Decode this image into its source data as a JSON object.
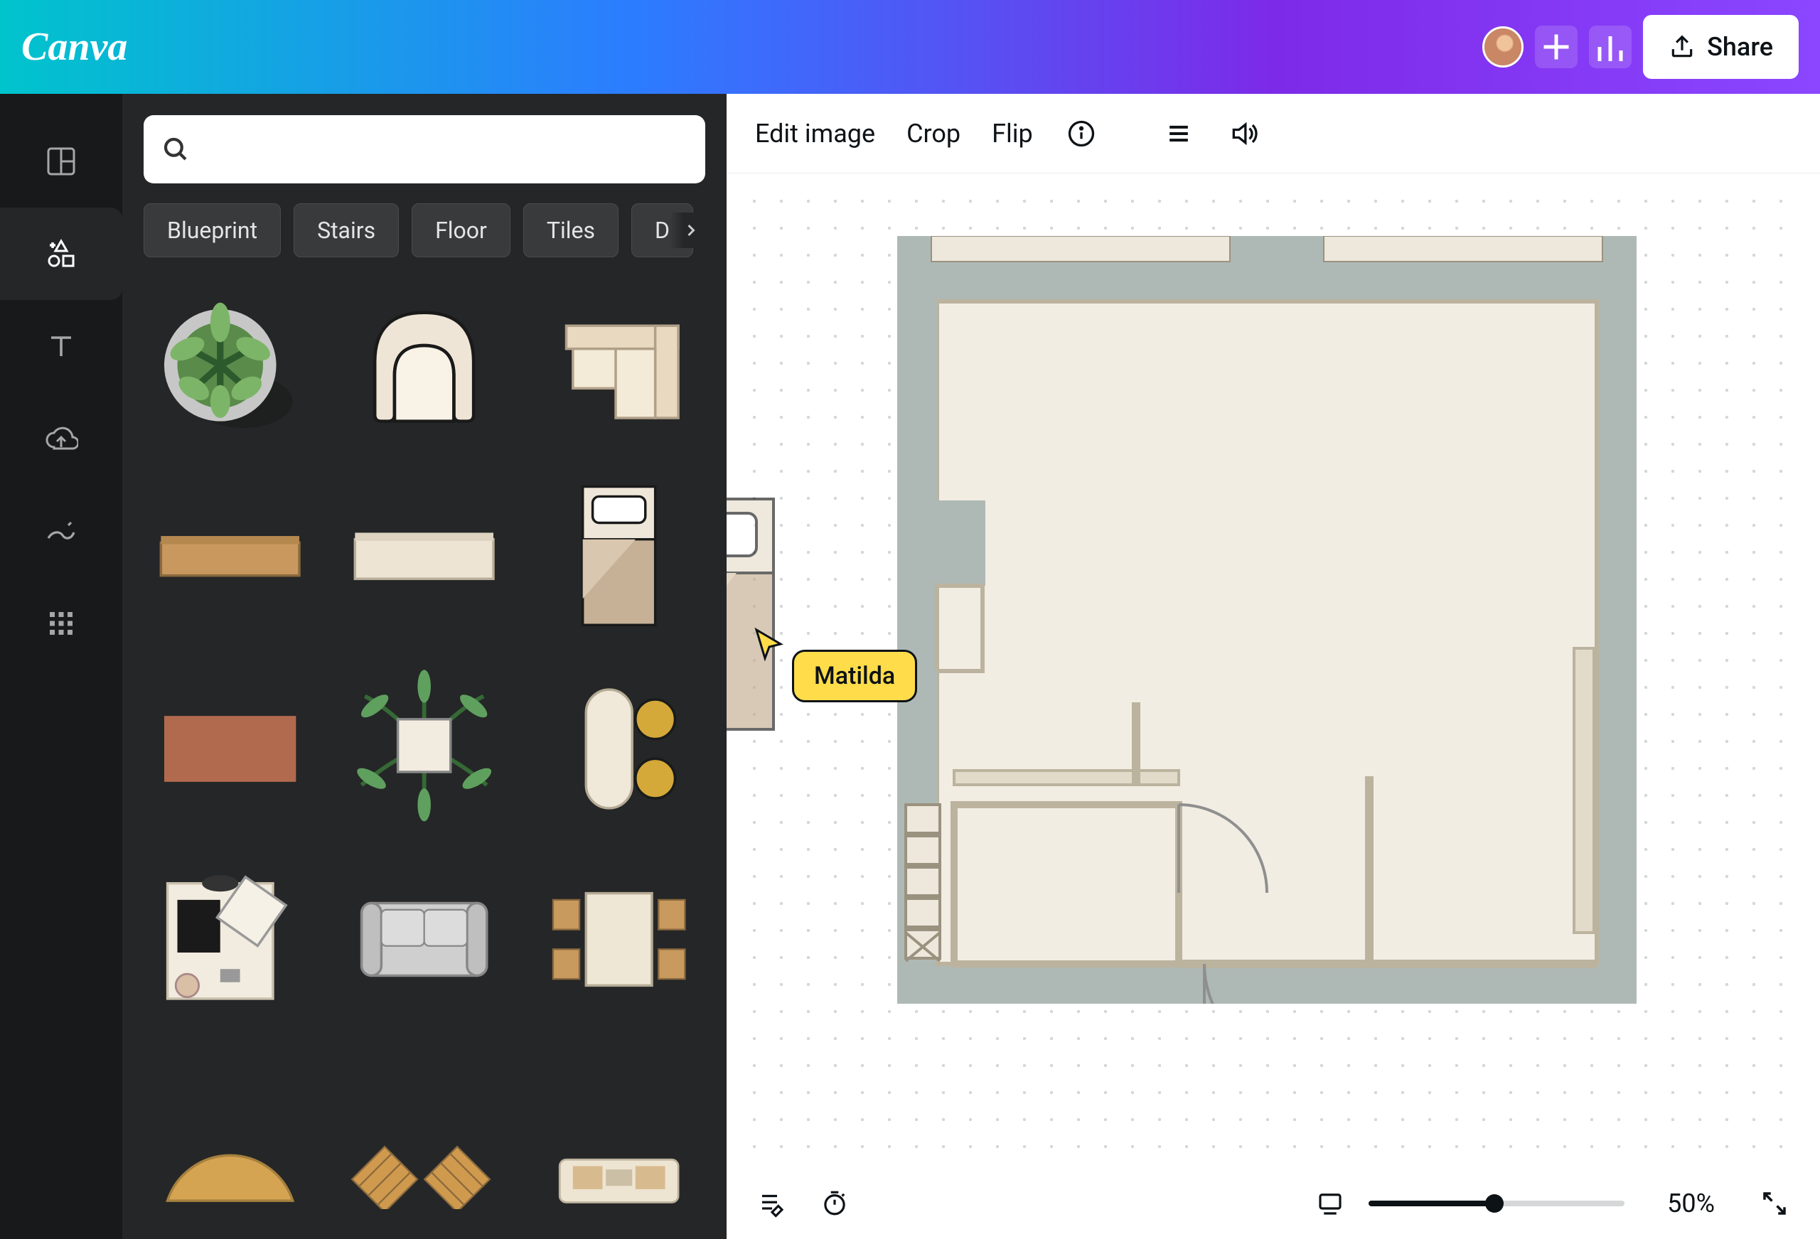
{
  "header": {
    "logo": "Canva",
    "share_label": "Share"
  },
  "toolbar": {
    "edit_image": "Edit image",
    "crop": "Crop",
    "flip": "Flip"
  },
  "side_panel": {
    "search_placeholder": "",
    "filters": [
      "Blueprint",
      "Stairs",
      "Floor",
      "Tiles",
      "D"
    ]
  },
  "collaborator": {
    "name": "Matilda",
    "tag_color": "#ffdc4a"
  },
  "footer": {
    "zoom_percent": "50%",
    "zoom_value": 50
  }
}
